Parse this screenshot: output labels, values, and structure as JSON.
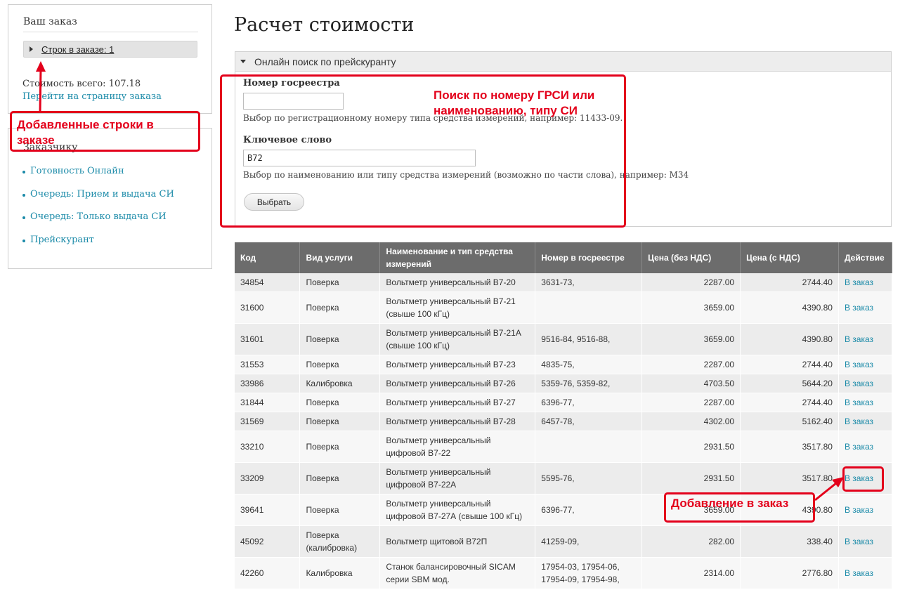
{
  "sidebar": {
    "order": {
      "title": "Ваш заказ",
      "rows_link": "Строк в заказе: 1",
      "total": "Стоимость всего: 107.18",
      "goto_link": "Перейти на страницу заказа"
    },
    "customer": {
      "title": "Заказчику",
      "items": [
        {
          "label": "Готовность Онлайн"
        },
        {
          "label": "Очередь: Прием и выдача СИ"
        },
        {
          "label": "Очередь: Только выдача СИ"
        },
        {
          "label": "Прейскурант"
        }
      ]
    }
  },
  "main": {
    "title": "Расчет стоимости",
    "search": {
      "legend": "Онлайн поиск по прейскуранту",
      "reg_label": "Номер госреестра",
      "reg_value": "",
      "reg_help": "Выбор по регистрационному номеру типа средства измерений, например: 11433-09.",
      "kw_label": "Ключевое слово",
      "kw_value": "В72",
      "kw_help": "Выбор по наименованию или типу средства измерений (возможно по части слова), например: М34",
      "submit": "Выбрать"
    },
    "table": {
      "headers": [
        "Код",
        "Вид услуги",
        "Наименование и тип средства измерений",
        "Номер в госреестре",
        "Цена (без НДС)",
        "Цена (с НДС)",
        "Действие"
      ],
      "rows": [
        {
          "code": "34854",
          "service": "Поверка",
          "name": "Вольтметр универсальный В7-20",
          "reg": "3631-73,",
          "price": "2287.00",
          "price_vat": "2744.40",
          "action": "В заказ"
        },
        {
          "code": "31600",
          "service": "Поверка",
          "name": "Вольтметр универсальный В7-21 (свыше 100 кГц)",
          "reg": "",
          "price": "3659.00",
          "price_vat": "4390.80",
          "action": "В заказ"
        },
        {
          "code": "31601",
          "service": "Поверка",
          "name": "Вольтметр универсальный В7-21А (свыше 100 кГц)",
          "reg": "9516-84, 9516-88,",
          "price": "3659.00",
          "price_vat": "4390.80",
          "action": "В заказ"
        },
        {
          "code": "31553",
          "service": "Поверка",
          "name": "Вольтметр универсальный В7-23",
          "reg": "4835-75,",
          "price": "2287.00",
          "price_vat": "2744.40",
          "action": "В заказ"
        },
        {
          "code": "33986",
          "service": "Калибровка",
          "name": "Вольтметр универсальный В7-26",
          "reg": "5359-76, 5359-82,",
          "price": "4703.50",
          "price_vat": "5644.20",
          "action": "В заказ"
        },
        {
          "code": "31844",
          "service": "Поверка",
          "name": "Вольтметр универсальный В7-27",
          "reg": "6396-77,",
          "price": "2287.00",
          "price_vat": "2744.40",
          "action": "В заказ"
        },
        {
          "code": "31569",
          "service": "Поверка",
          "name": "Вольтметр универсальный В7-28",
          "reg": "6457-78,",
          "price": "4302.00",
          "price_vat": "5162.40",
          "action": "В заказ"
        },
        {
          "code": "33210",
          "service": "Поверка",
          "name": "Вольтметр универсальный цифровой В7-22",
          "reg": "",
          "price": "2931.50",
          "price_vat": "3517.80",
          "action": "В заказ"
        },
        {
          "code": "33209",
          "service": "Поверка",
          "name": "Вольтметр универсальный цифровой В7-22А",
          "reg": "5595-76,",
          "price": "2931.50",
          "price_vat": "3517.80",
          "action": "В заказ"
        },
        {
          "code": "39641",
          "service": "Поверка",
          "name": "Вольтметр универсальный цифровой В7-27А (свыше 100 кГц)",
          "reg": "6396-77,",
          "price": "3659.00",
          "price_vat": "4390.80",
          "action": "В заказ"
        },
        {
          "code": "45092",
          "service": "Поверка (калибровка)",
          "name": "Вольтметр щитовой В72П",
          "reg": "41259-09,",
          "price": "282.00",
          "price_vat": "338.40",
          "action": "В заказ"
        },
        {
          "code": "42260",
          "service": "Калибровка",
          "name": "Станок балансировочный SICAM серии SBM мод.",
          "reg": "17954-03, 17954-06, 17954-09, 17954-98,",
          "price": "2314.00",
          "price_vat": "2776.80",
          "action": "В заказ"
        }
      ]
    }
  },
  "annotations": {
    "order_rows": "Добавленные строки в заказе",
    "search_hint": "Поиск по номеру ГРСИ или наименованию, типу СИ",
    "add_to_order": "Добавление в заказ"
  },
  "colors": {
    "link": "#1a8aa8",
    "table_header": "#6c6c6c",
    "annotation": "#e3001b"
  }
}
